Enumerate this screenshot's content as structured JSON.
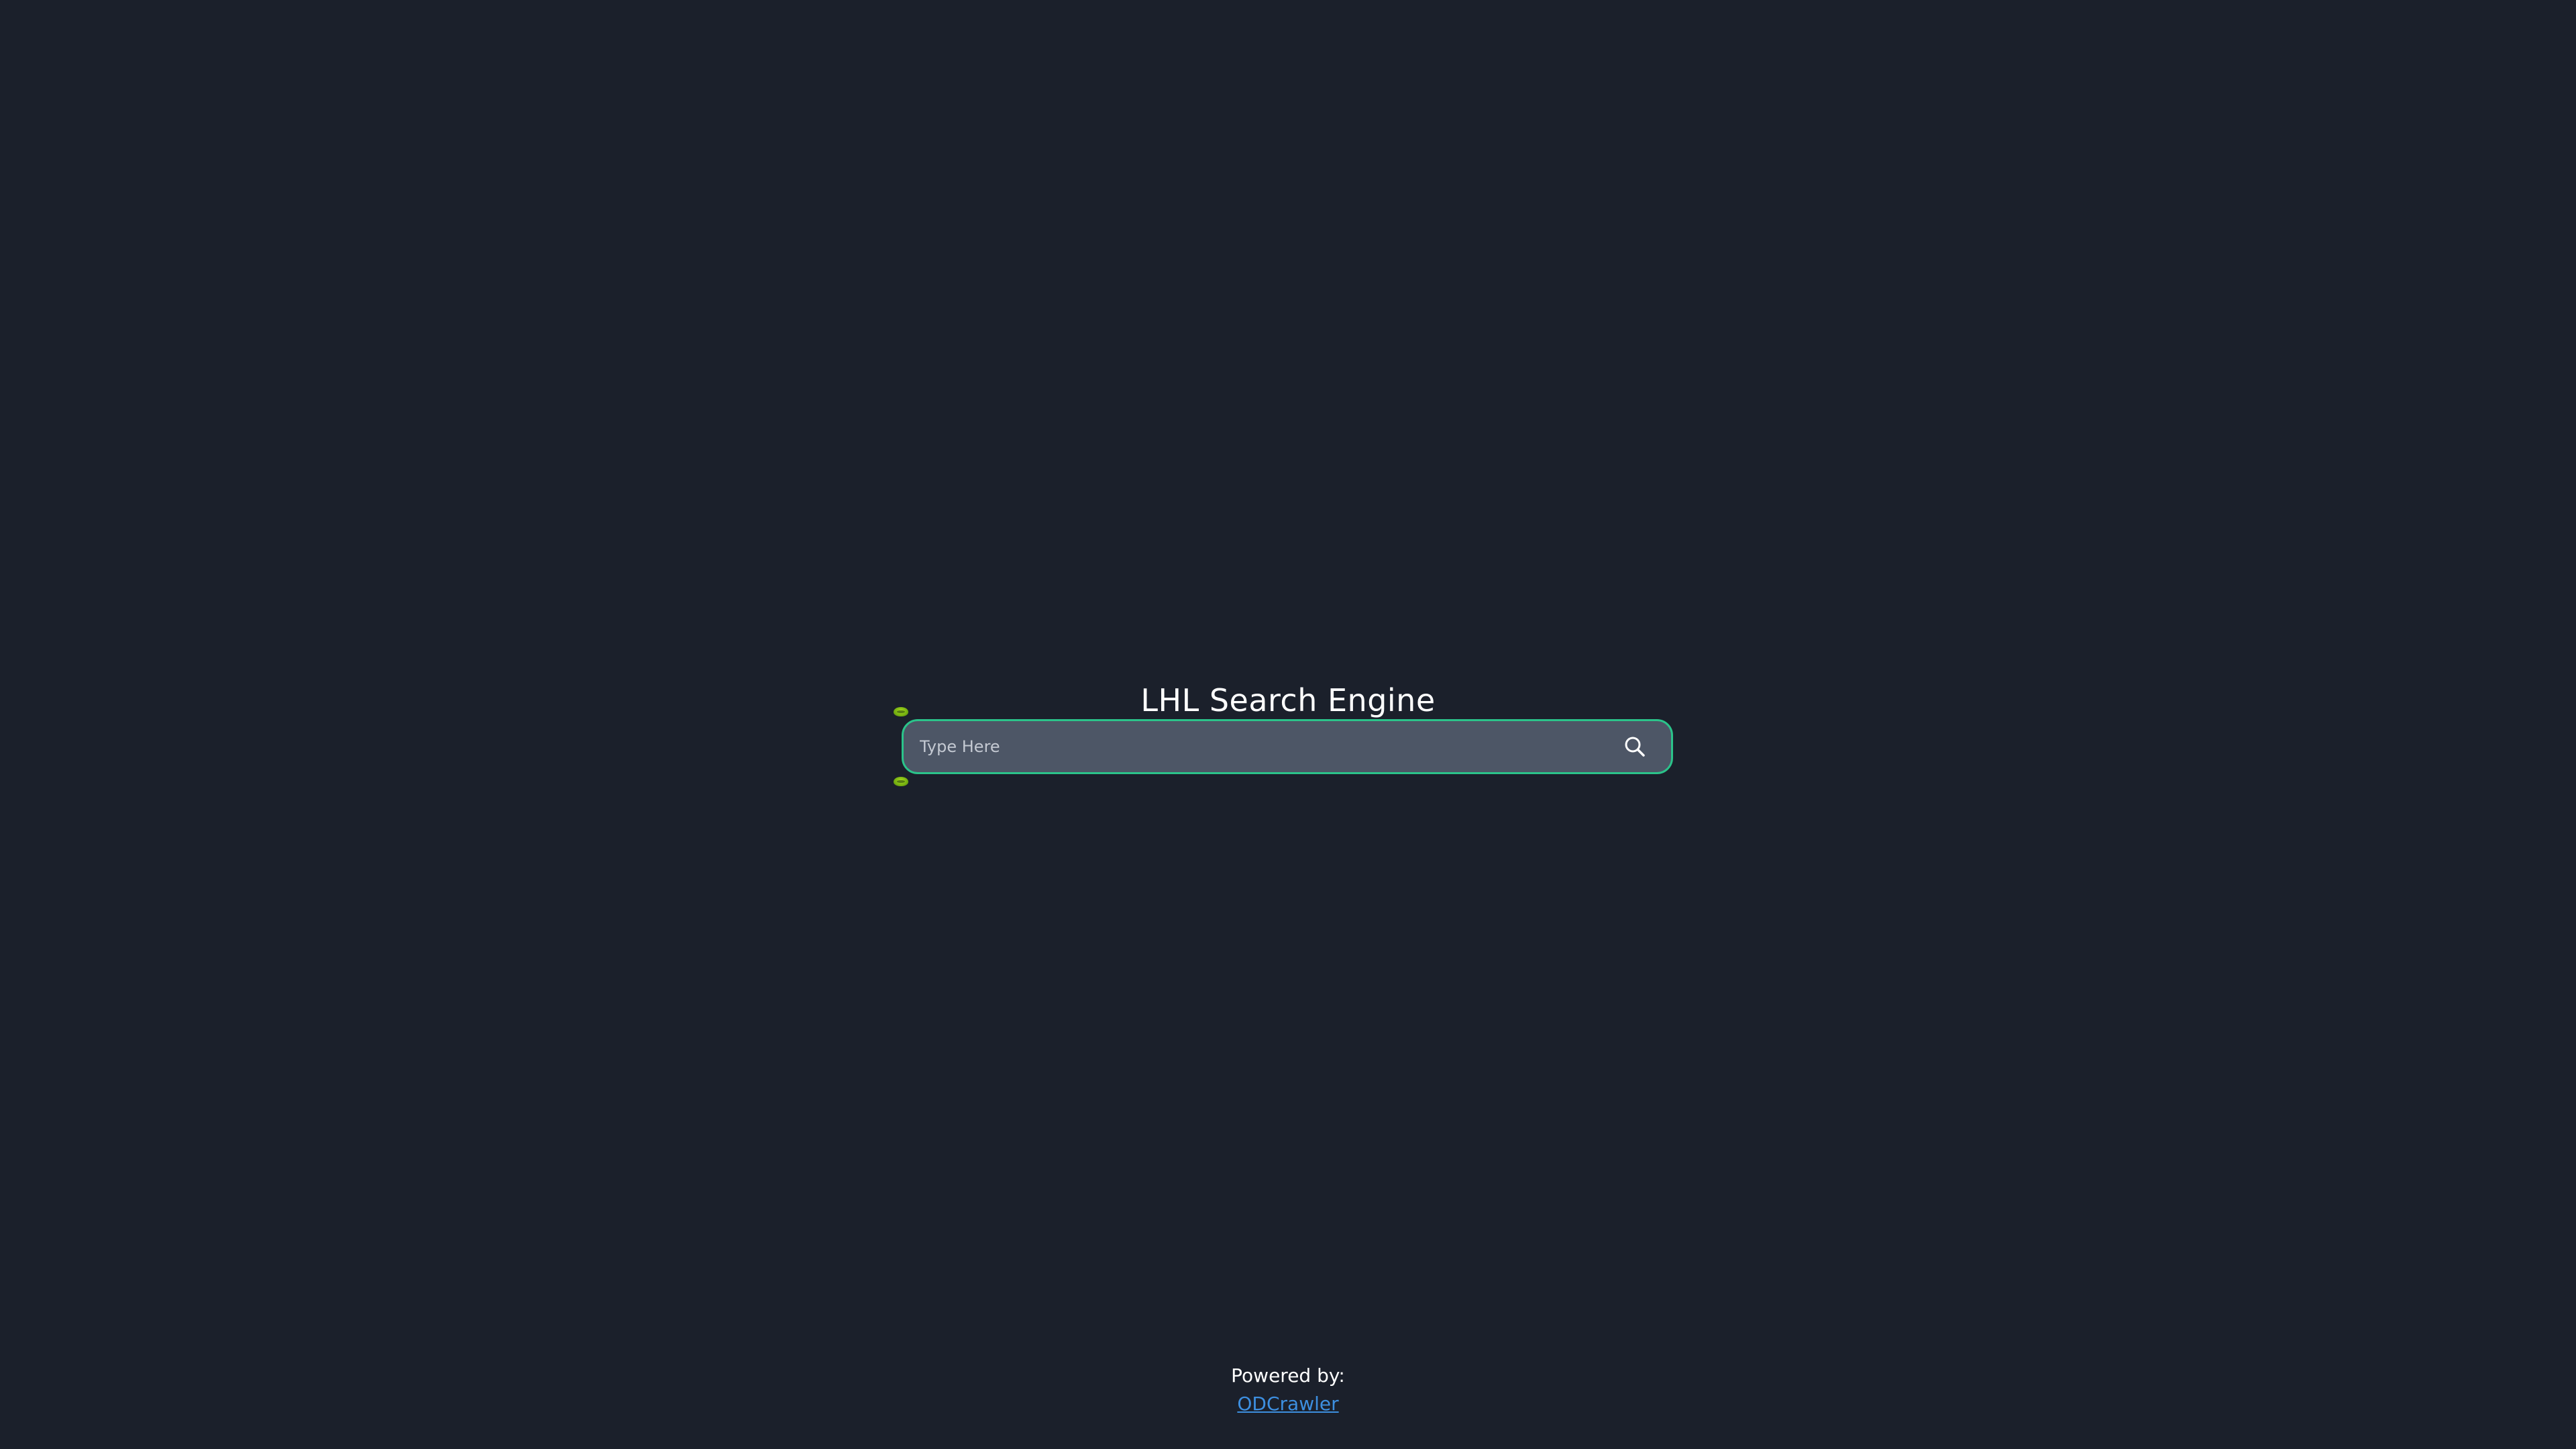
{
  "page": {
    "title": "LHL Search Engine"
  },
  "search": {
    "placeholder": "Type Here",
    "value": "",
    "button_icon": "search-icon"
  },
  "footer": {
    "powered_label": "Powered by:",
    "link_text": "ODCrawler"
  },
  "colors": {
    "background": "#1b202b",
    "search_background": "#4d5666",
    "search_border": "#2bc38a",
    "link": "#3d8fe0",
    "decoration": "#79b312"
  }
}
